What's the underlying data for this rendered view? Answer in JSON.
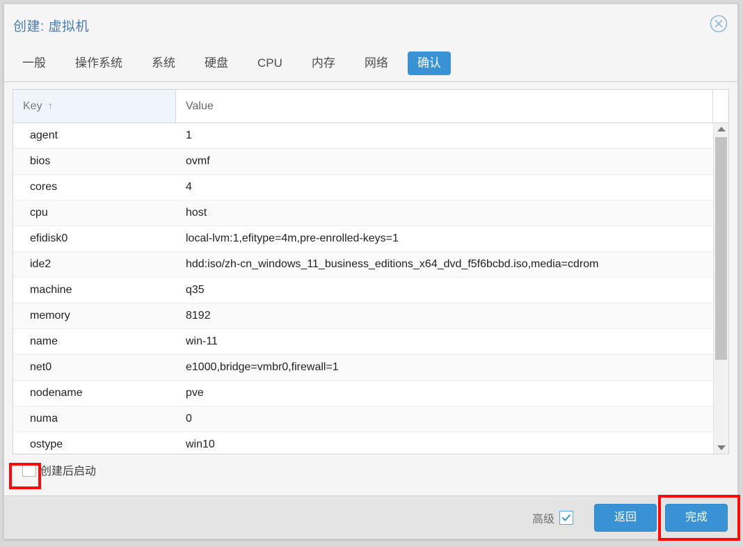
{
  "dialog": {
    "title": "创建: 虚拟机",
    "close_icon": "close-circle-icon"
  },
  "tabs": [
    {
      "label": "一般",
      "name": "general",
      "active": false
    },
    {
      "label": "操作系统",
      "name": "os",
      "active": false
    },
    {
      "label": "系统",
      "name": "system",
      "active": false
    },
    {
      "label": "硬盘",
      "name": "disks",
      "active": false
    },
    {
      "label": "CPU",
      "name": "cpu",
      "active": false
    },
    {
      "label": "内存",
      "name": "memory",
      "active": false
    },
    {
      "label": "网络",
      "name": "network",
      "active": false
    },
    {
      "label": "确认",
      "name": "confirm",
      "active": true
    }
  ],
  "grid": {
    "columns": {
      "key": "Key",
      "value": "Value",
      "sort_indicator": "↑"
    },
    "rows": [
      {
        "key": "agent",
        "value": "1"
      },
      {
        "key": "bios",
        "value": "ovmf"
      },
      {
        "key": "cores",
        "value": "4"
      },
      {
        "key": "cpu",
        "value": "host"
      },
      {
        "key": "efidisk0",
        "value": "local-lvm:1,efitype=4m,pre-enrolled-keys=1"
      },
      {
        "key": "ide2",
        "value": "hdd:iso/zh-cn_windows_11_business_editions_x64_dvd_f5f6bcbd.iso,media=cdrom"
      },
      {
        "key": "machine",
        "value": "q35"
      },
      {
        "key": "memory",
        "value": "8192"
      },
      {
        "key": "name",
        "value": "win-11"
      },
      {
        "key": "net0",
        "value": "e1000,bridge=vmbr0,firewall=1"
      },
      {
        "key": "nodename",
        "value": "pve"
      },
      {
        "key": "numa",
        "value": "0"
      },
      {
        "key": "ostype",
        "value": "win10"
      }
    ]
  },
  "startup": {
    "label": "创建后启动",
    "checked": false
  },
  "footer": {
    "advanced_label": "高级",
    "advanced_checked": true,
    "back_label": "返回",
    "finish_label": "完成"
  },
  "colors": {
    "accent": "#3892d4",
    "title": "#4c7cb0",
    "header_highlight": "#eef5fb",
    "annotation": "#fb0a0a",
    "footer_bg": "#e4e4e4"
  }
}
